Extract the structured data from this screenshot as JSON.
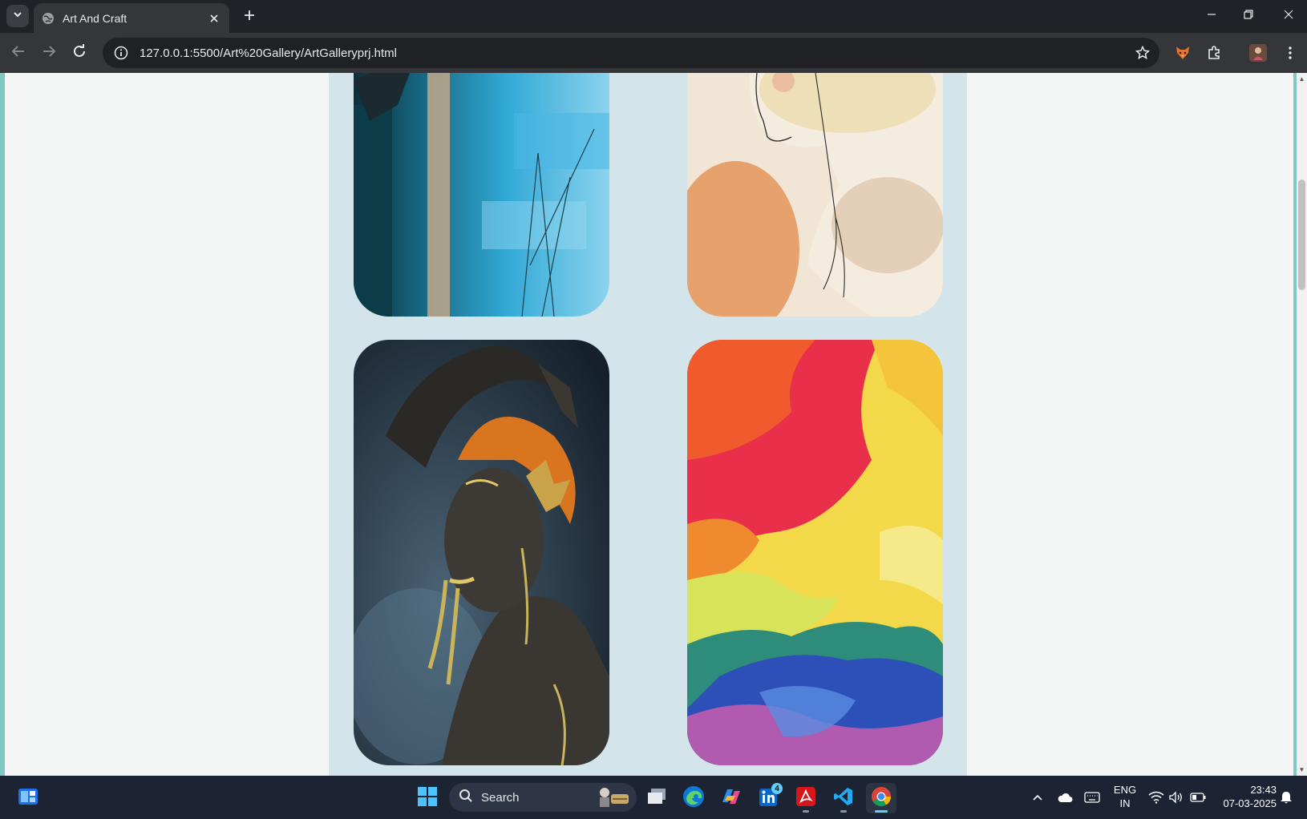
{
  "browser": {
    "tab": {
      "title": "Art And Craft"
    },
    "address_bar": {
      "url": "127.0.0.1:5500/Art%20Gallery/ArtGalleryprj.html"
    }
  },
  "gallery": {
    "background_color": "#d3e5ea",
    "artworks": [
      {
        "name": "blue-wall-mural"
      },
      {
        "name": "watercolor-portrait"
      },
      {
        "name": "golden-body-art"
      },
      {
        "name": "fluid-ink-abstract"
      }
    ]
  },
  "taskbar": {
    "search_label": "Search",
    "linkedin_badge": "4",
    "language": {
      "line1": "ENG",
      "line2": "IN"
    },
    "clock": {
      "time": "23:43",
      "date": "07-03-2025"
    }
  },
  "colors": {
    "accent": "#7fc7c0",
    "page_bg": "#f4f5f5",
    "chrome_dark": "#1f2226",
    "taskbar": "#1c2434"
  }
}
